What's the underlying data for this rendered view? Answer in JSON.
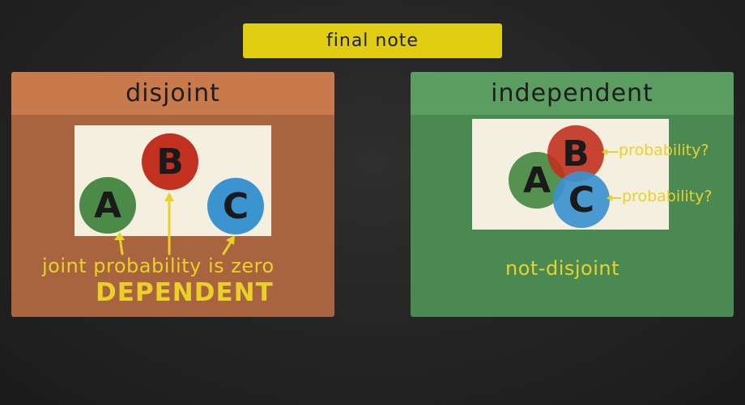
{
  "banner": {
    "title": "final note"
  },
  "left_panel": {
    "header": "disjoint",
    "circles": {
      "a": "A",
      "b": "B",
      "c": "C"
    },
    "caption": "joint probability is zero",
    "verdict": "DEPENDENT",
    "colors": {
      "panel": "#a8643e",
      "header": "#c97a4c",
      "a": "#4c8b47",
      "b": "#c2301f",
      "c": "#3b93cf"
    }
  },
  "right_panel": {
    "header": "independent",
    "circles": {
      "a": "A",
      "b": "B",
      "c": "C"
    },
    "label_1": "probability?",
    "label_2": "probability?",
    "caption": "not-disjoint",
    "colors": {
      "panel": "#4a8a52",
      "header": "#5c9d62",
      "a": "#4c8b47",
      "b": "#c2301f",
      "c": "#3b93cf"
    }
  },
  "accent": "#ead12a"
}
